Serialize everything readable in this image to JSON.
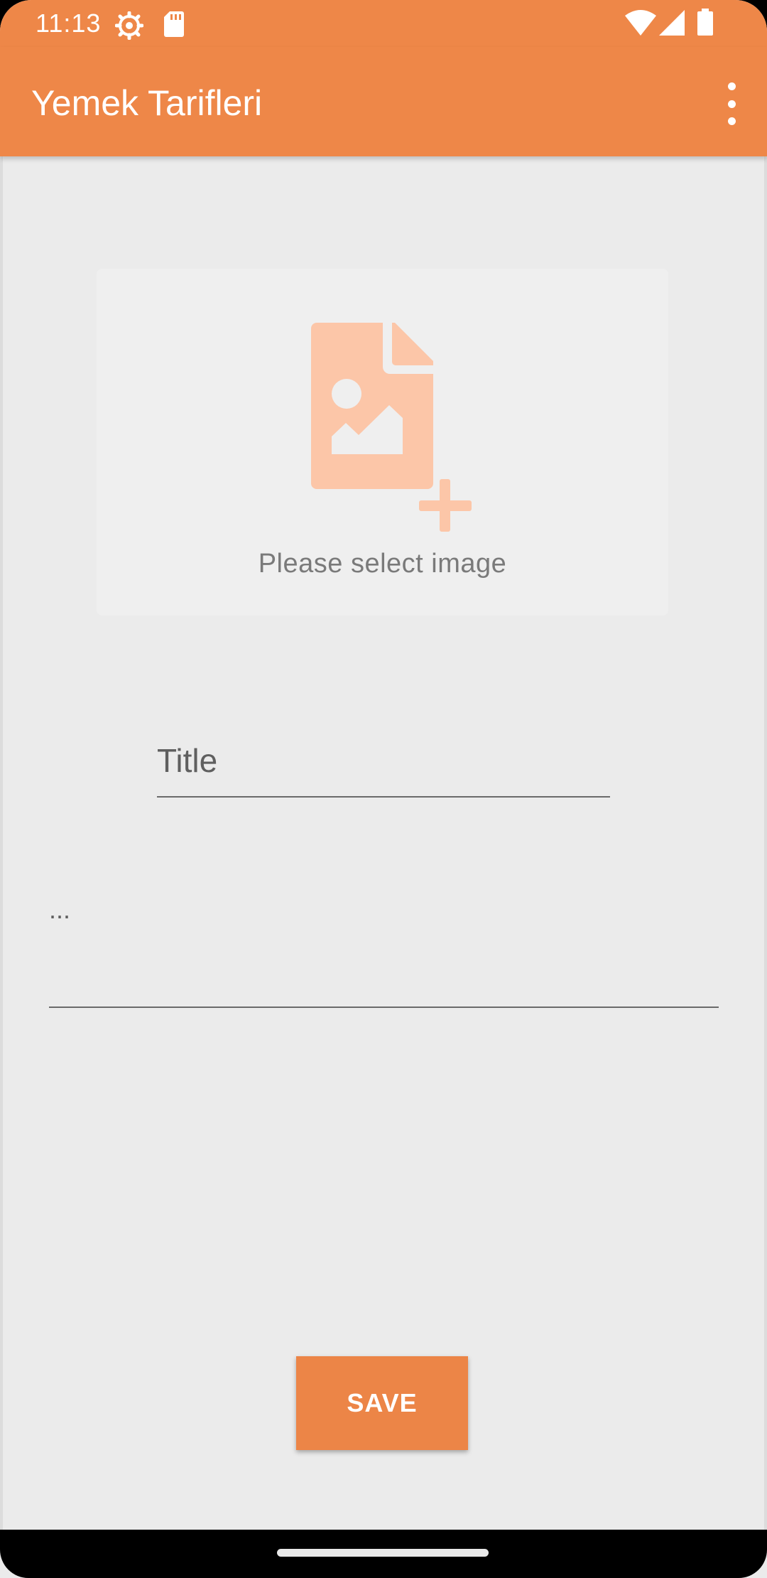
{
  "status_bar": {
    "time": "11:13",
    "icons": [
      "settings-icon",
      "sd-card-icon",
      "wifi-icon",
      "signal-icon",
      "battery-icon"
    ]
  },
  "app_bar": {
    "title": "Yemek Tarifleri",
    "menu_icon": "more-vert-icon"
  },
  "image_picker": {
    "icon": "add-image-file-icon",
    "label": "Please select image"
  },
  "form": {
    "title_placeholder": "Title",
    "title_value": "",
    "description_placeholder": "...",
    "description_value": ""
  },
  "actions": {
    "save_label": "SAVE"
  },
  "colors": {
    "primary": "#ee8748",
    "accent_icon": "#fcc6a8",
    "background": "#ebebeb"
  }
}
